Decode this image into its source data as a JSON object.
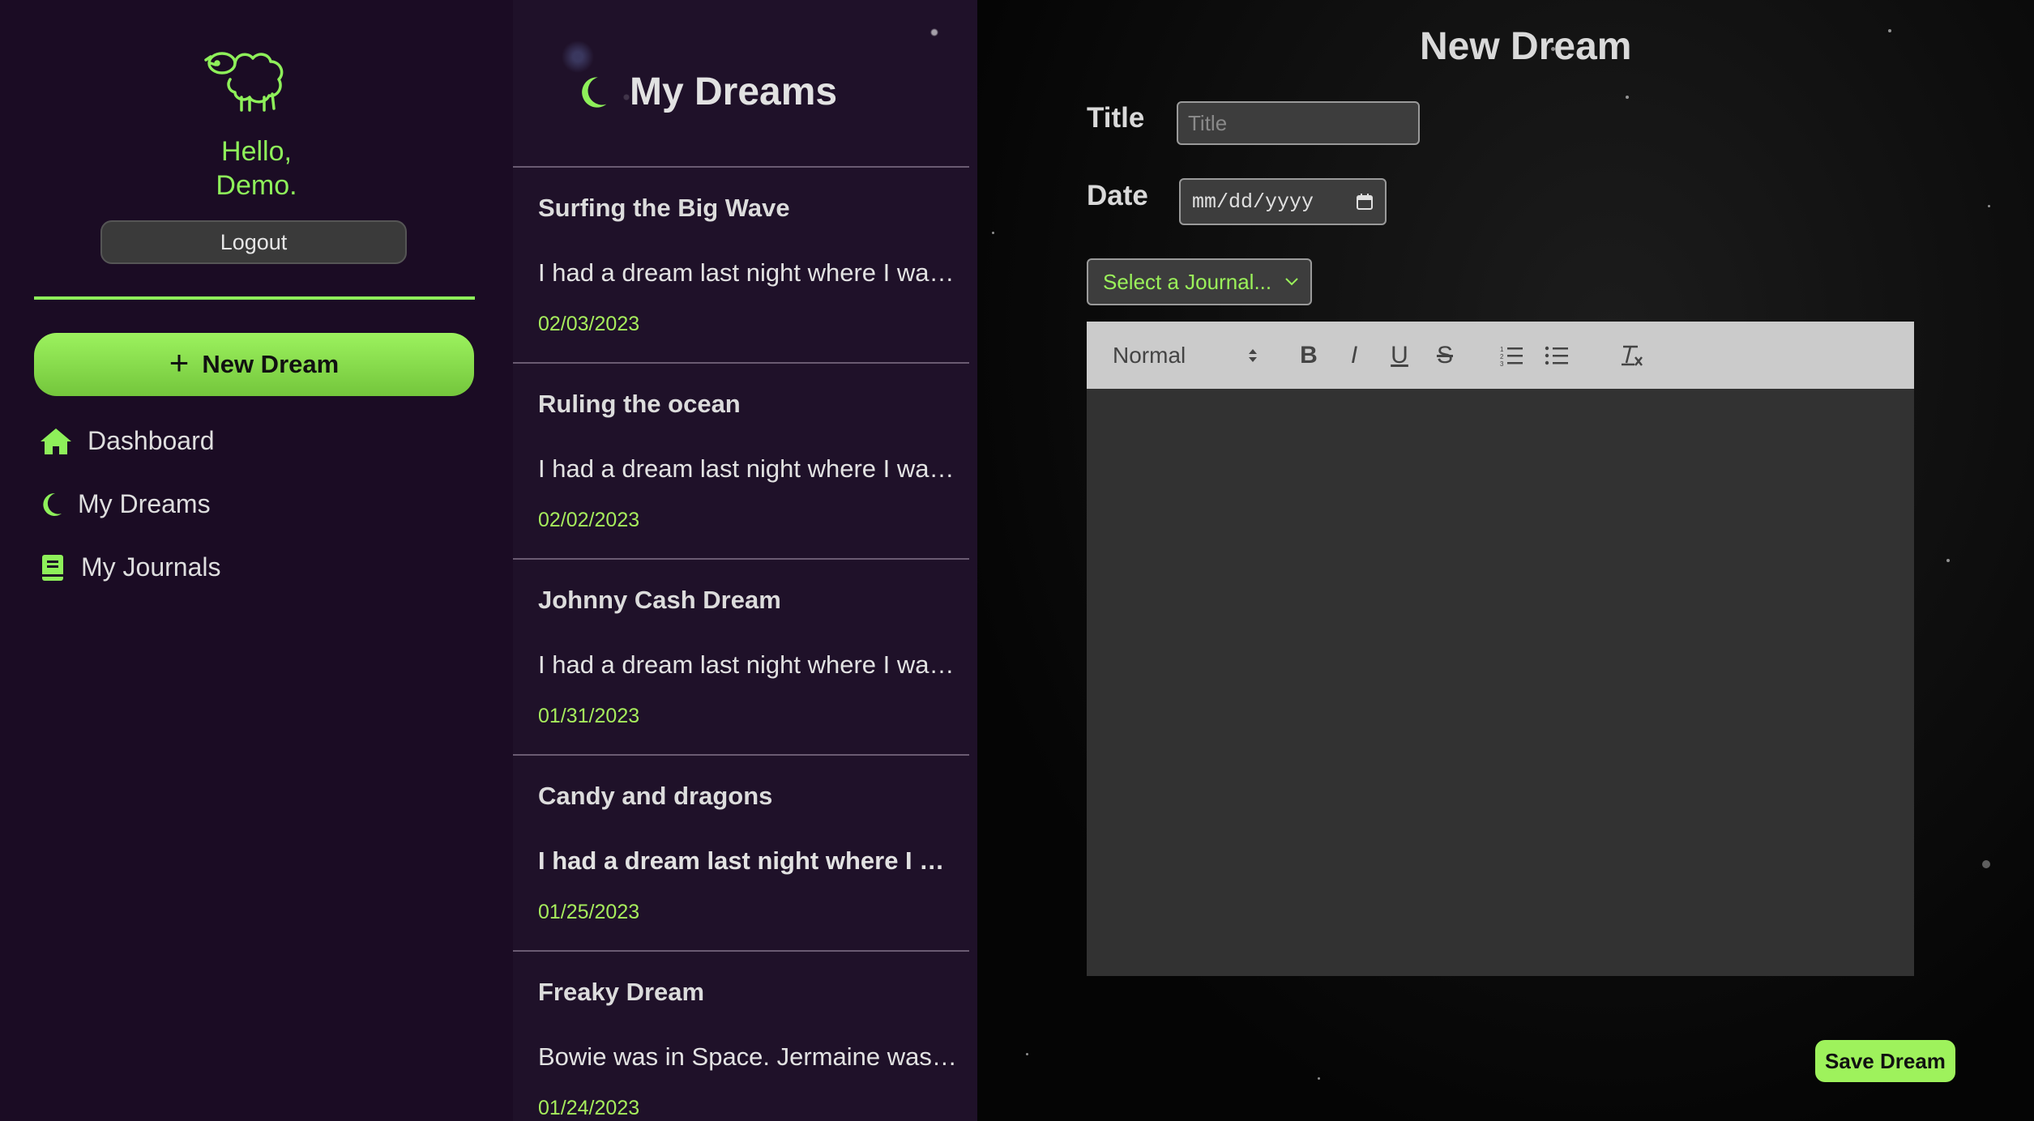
{
  "sidebar": {
    "greeting_line1": "Hello,",
    "greeting_line2": "Demo.",
    "logout_label": "Logout",
    "new_dream_label": "New Dream",
    "nav": [
      {
        "label": "Dashboard",
        "icon": "home-icon"
      },
      {
        "label": "My Dreams",
        "icon": "moon-icon"
      },
      {
        "label": "My Journals",
        "icon": "book-icon"
      }
    ]
  },
  "list": {
    "title": "My Dreams",
    "items": [
      {
        "title": "Surfing the Big Wave",
        "snippet": "I had a dream last night where I was surfing",
        "date": "02/03/2023"
      },
      {
        "title": "Ruling the ocean",
        "snippet": "I had a dream last night where I was ruling",
        "date": "02/02/2023"
      },
      {
        "title": "Johnny Cash Dream",
        "snippet": "I had a dream last night where I was singing",
        "date": "01/31/2023"
      },
      {
        "title": "Candy and dragons",
        "snippet": "I had a dream last night where I was flying",
        "date": "01/25/2023"
      },
      {
        "title": "Freaky Dream",
        "snippet": "Bowie was in Space. Jermaine was there too",
        "date": "01/24/2023"
      }
    ]
  },
  "editor": {
    "page_title": "New Dream",
    "title_label": "Title",
    "title_placeholder": "Title",
    "date_label": "Date",
    "date_placeholder": "mm/dd/yyyy",
    "journal_select_value": "Select a Journal...",
    "toolbar": {
      "heading_value": "Normal",
      "bold": "B",
      "italic": "I",
      "underline": "U",
      "strike": "S"
    },
    "save_label": "Save Dream"
  },
  "colors": {
    "accent": "#8ef05a",
    "sidebar_bg": "#1b0c24",
    "list_bg": "#1f1129"
  }
}
